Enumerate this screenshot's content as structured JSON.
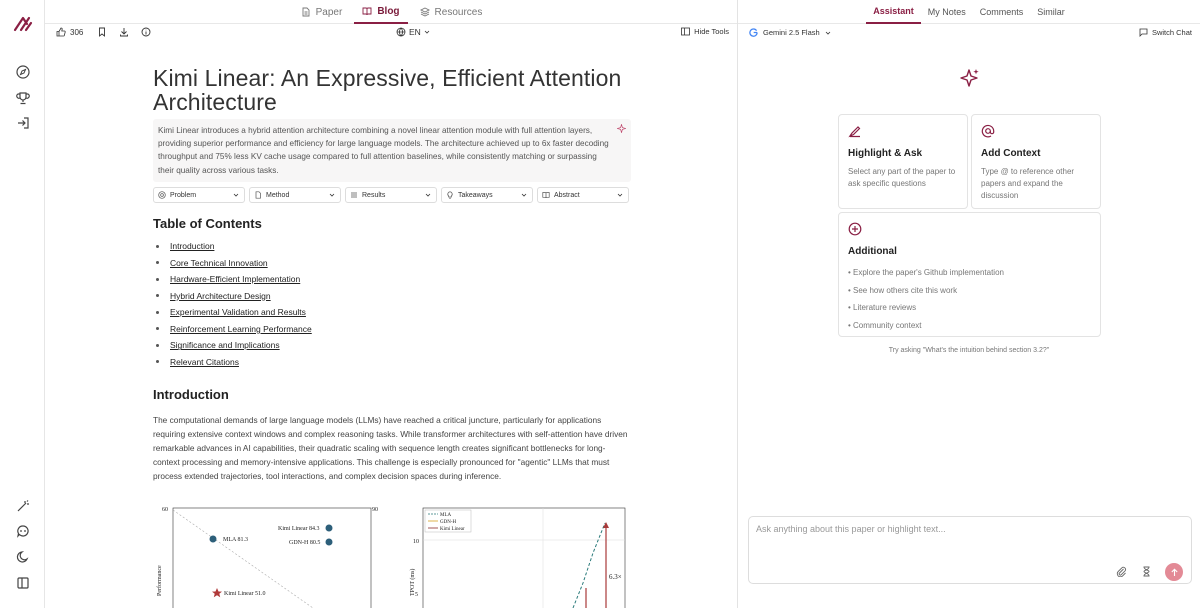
{
  "colors": {
    "accent": "#8a1f44",
    "send": "#e38a96",
    "muted": "#777777"
  },
  "rail": {
    "icons": [
      "logo-icon",
      "compass-icon",
      "trophy-icon",
      "sign-in-icon",
      "magic-wand-icon",
      "chat-icon",
      "moon-icon",
      "sidebar-toggle-icon"
    ]
  },
  "tabs": [
    {
      "label": "Paper",
      "icon": "document-icon"
    },
    {
      "label": "Blog",
      "icon": "book-icon",
      "active": true
    },
    {
      "label": "Resources",
      "icon": "layers-icon"
    }
  ],
  "toolbar": {
    "likes": "306",
    "language": "EN",
    "hide_tools": "Hide Tools"
  },
  "doc": {
    "title": "Kimi Linear: An Expressive, Efficient Attention Architecture",
    "summary": "Kimi Linear introduces a hybrid attention architecture combining a novel linear attention module with full attention layers, providing superior performance and efficiency for large language models. The architecture achieved up to 6x faster decoding throughput and 75% less KV cache usage compared to full attention baselines, while consistently matching or surpassing their quality across various tasks.",
    "selectors": [
      {
        "label": "Problem",
        "icon": "target-icon"
      },
      {
        "label": "Method",
        "icon": "file-icon"
      },
      {
        "label": "Results",
        "icon": "list-icon"
      },
      {
        "label": "Takeaways",
        "icon": "lightbulb-icon"
      },
      {
        "label": "Abstract",
        "icon": "book-icon"
      }
    ],
    "toc_title": "Table of Contents",
    "toc": [
      "Introduction",
      "Core Technical Innovation",
      "Hardware-Efficient Implementation",
      "Hybrid Architecture Design",
      "Experimental Validation and Results",
      "Reinforcement Learning Performance",
      "Significance and Implications",
      "Relevant Citations"
    ],
    "intro_title": "Introduction",
    "intro_text": "The computational demands of large language models (LLMs) have reached a critical juncture, particularly for applications requiring extensive context windows and complex reasoning tasks. While transformer architectures with self-attention have driven remarkable advances in AI capabilities, their quadratic scaling with sequence length creates significant bottlenecks for long-context processing and memory-intensive applications. This challenge is especially pronounced for \"agentic\" LLMs that must process extended trajectories, tool interactions, and complex decision spaces during inference."
  },
  "figure": {
    "left": {
      "y_top": "60",
      "y_right": "90",
      "ylabel": "Performance",
      "points": [
        "MLA 81.3",
        "Kimi Linear 84.3",
        "GDN-H 80.5",
        "Kimi Linear 51.0"
      ]
    },
    "right": {
      "legend": [
        "MLA",
        "GDN-H",
        "Kimi Linear"
      ],
      "ylabel": "TPOT (ms)",
      "ticks": [
        "10",
        "5"
      ],
      "annotation": "6.3×"
    }
  },
  "right": {
    "tabs": [
      {
        "label": "Assistant",
        "active": true
      },
      {
        "label": "My Notes"
      },
      {
        "label": "Comments"
      },
      {
        "label": "Similar"
      }
    ],
    "model": "Gemini 2.5 Flash",
    "switch": "Switch Chat",
    "cards": {
      "highlight": {
        "title": "Highlight & Ask",
        "desc": "Select any part of the paper to ask specific questions"
      },
      "context": {
        "title": "Add Context",
        "desc": "Type @ to reference other papers and expand the discussion"
      },
      "additional": {
        "title": "Additional",
        "items": [
          "• Explore the paper's Github implementation",
          "• See how others cite this work",
          "• Literature reviews",
          "• Community context"
        ]
      }
    },
    "hint": "Try asking \"What's the intuition behind section 3.2?\"",
    "chat_placeholder": "Ask anything about this paper or highlight text..."
  }
}
